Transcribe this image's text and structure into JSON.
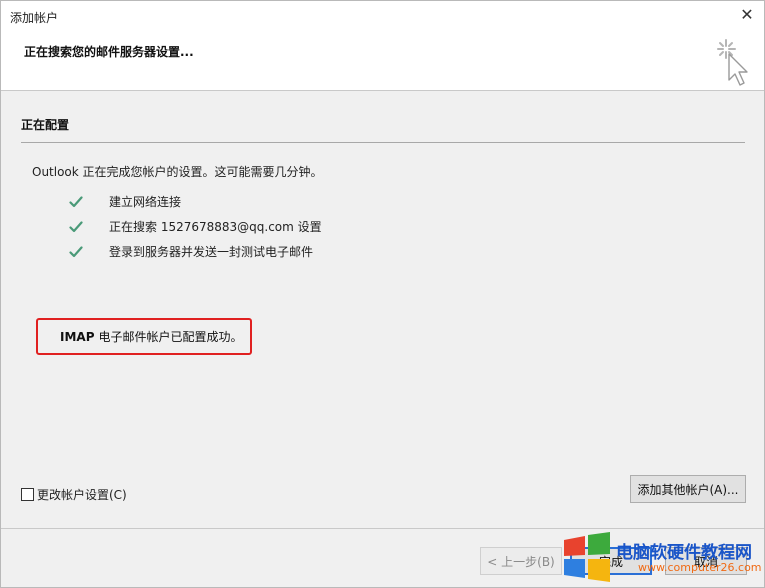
{
  "window": {
    "title": "添加帐户",
    "close_glyph": "✕"
  },
  "header": {
    "heading": "正在搜索您的邮件服务器设置...",
    "icon": "busy-cursor-icon"
  },
  "section": {
    "title": "正在配置",
    "description": "Outlook 正在完成您帐户的设置。这可能需要几分钟。",
    "steps": [
      {
        "label": "建立网络连接",
        "status": "done"
      },
      {
        "label": "正在搜索 1527678883@qq.com 设置",
        "status": "done"
      },
      {
        "label": "登录到服务器并发送一封测试电子邮件",
        "status": "done"
      }
    ],
    "success_bold": "IMAP",
    "success_text": "电子邮件帐户已配置成功。",
    "highlight_color": "#e02020"
  },
  "options": {
    "change_settings_label": "更改帐户设置(C)",
    "change_settings_checked": false,
    "add_other_label": "添加其他帐户(A)..."
  },
  "footer": {
    "back_label": "< 上一步(B)",
    "finish_label": "完成",
    "cancel_label": "取消"
  },
  "watermark": {
    "main": "电脑软硬件教程网",
    "sub": "www.computer26.com",
    "colors": [
      "#e8432e",
      "#3daa3d",
      "#2e7fe0",
      "#f5b50f"
    ]
  },
  "colors": {
    "check": "#4a9a78",
    "accent": "#2a6fd6"
  }
}
